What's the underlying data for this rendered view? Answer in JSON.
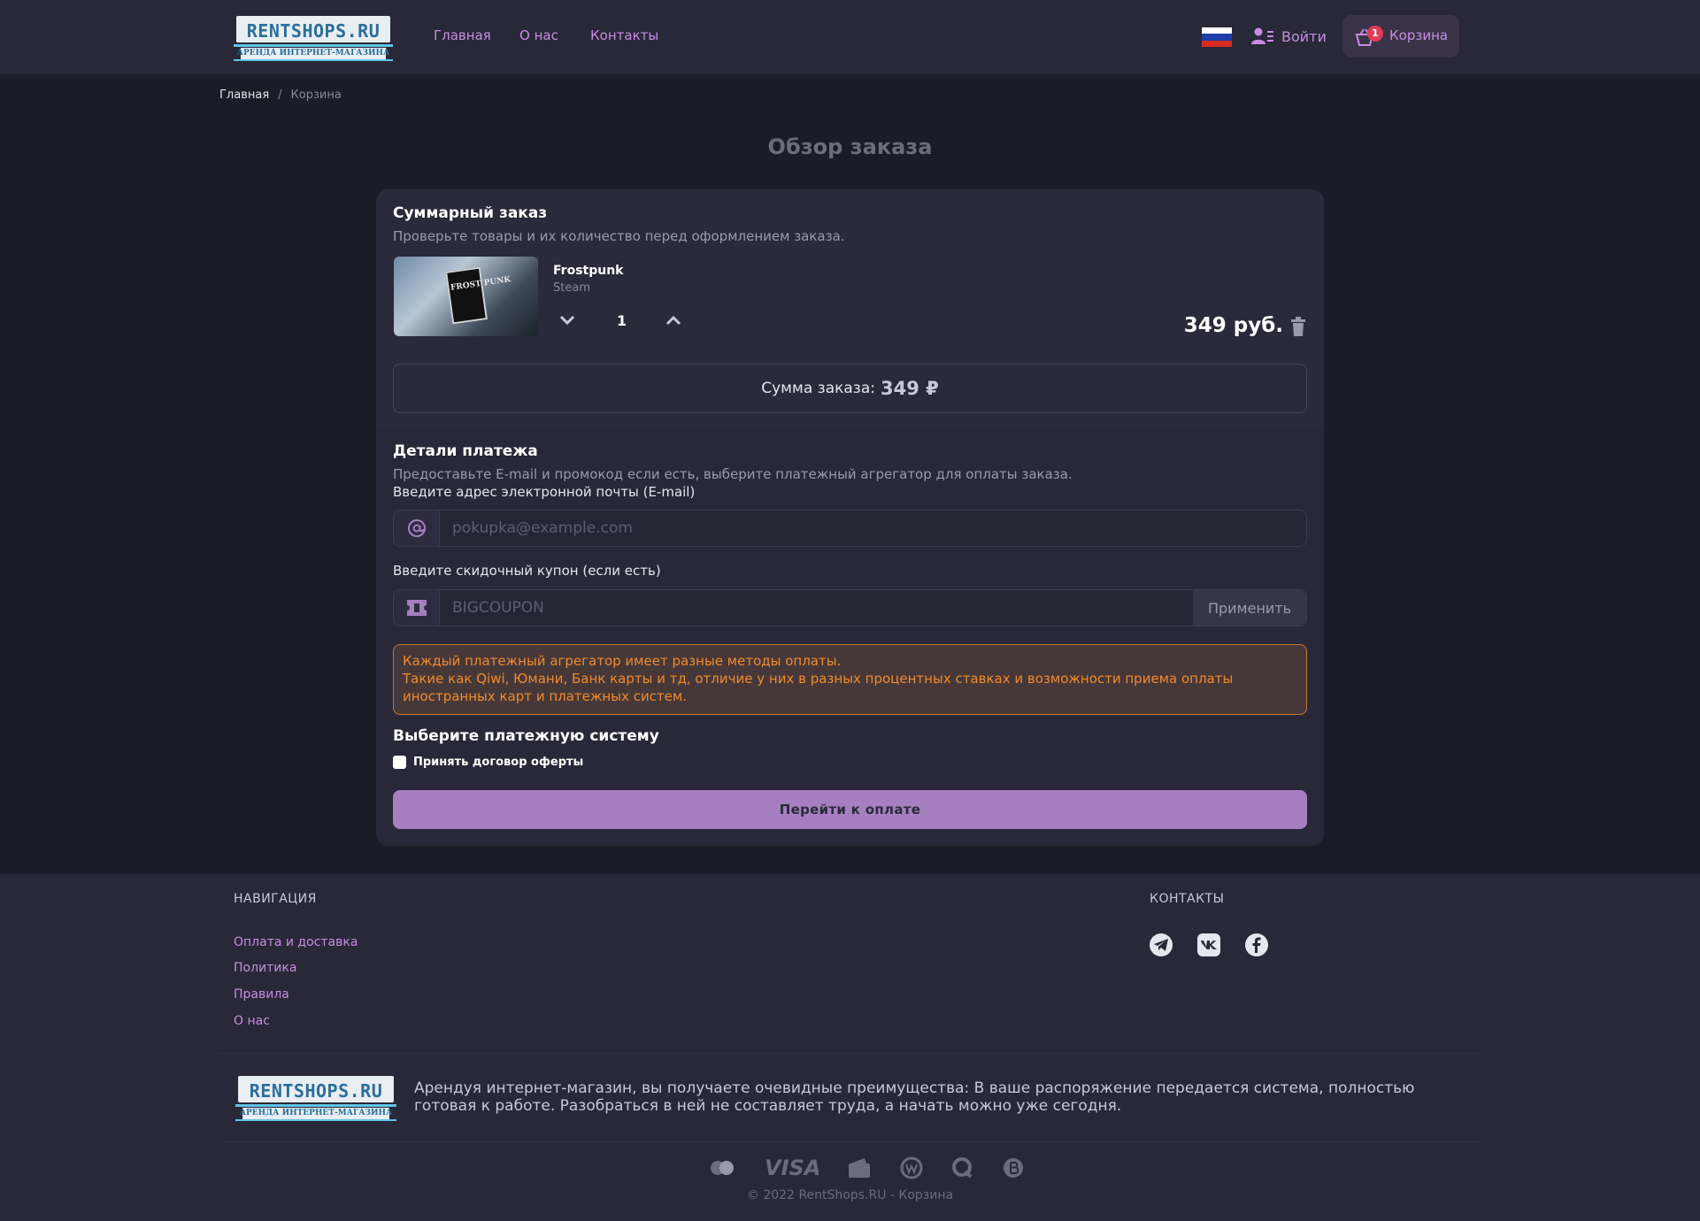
{
  "header": {
    "logo_main": "RENTSHOPS.RU",
    "logo_sub": "АРЕНДА ИНТЕРНЕТ-МАГАЗИНА",
    "nav": [
      "Главная",
      "О нас",
      "Контакты"
    ],
    "login_label": "Войти",
    "cart_label": "Корзина",
    "cart_count": "1",
    "flag_colors": [
      "#ffffff",
      "#1c3fa8",
      "#d52b1e"
    ]
  },
  "breadcrumb": {
    "home": "Главная",
    "separator": "/",
    "current": "Корзина"
  },
  "page_title": "Обзор заказа",
  "order": {
    "title": "Суммарный заказ",
    "subtitle": "Проверьте товары и их количество перед оформлением заказа.",
    "item": {
      "name": "Frostpunk",
      "platform": "Steam",
      "image_text": "FROST PUNK",
      "quantity": "1",
      "price": "349 руб."
    },
    "total_label": "Сумма заказа:",
    "total_value": "349 ₽"
  },
  "payment": {
    "title": "Детали платежа",
    "subtitle": "Предоставьте E-mail и промокод если есть, выберите платежный агрегатор для оплаты заказа.",
    "email_label": "Введите адрес электронной почты (E-mail)",
    "email_placeholder": "pokupka@example.com",
    "coupon_label": "Введите скидочный купон (если есть)",
    "coupon_placeholder": "BIGCOUPON",
    "apply_label": "Применить",
    "warning_line1": "Каждый платежный агрегатор имеет разные методы оплаты.",
    "warning_line2": "Такие как Qiwi, Юмани, Банк карты и тд, отличие у них в разных процентных ставках и возможности приема оплаты иностранных карт и платежных систем.",
    "system_title": "Выберите платежную систему",
    "offer_label": "Принять договор оферты",
    "pay_button": "Перейти к оплате"
  },
  "footer": {
    "nav_title": "НАВИГАЦИЯ",
    "links": [
      "Оплата и доставка",
      "Политика",
      "Правила",
      "О нас"
    ],
    "contacts_title": "КОНТАКТЫ",
    "socials": [
      "telegram-icon",
      "vk-icon",
      "facebook-icon"
    ],
    "description": "Арендуя интернет-магазин, вы получаете очевидные преимущества: В ваше распоряжение передается система, полностью готовая к работе. Разобраться в ней не составляет труда, а начать можно уже сегодня.",
    "payment_icons": [
      "mastercard-icon",
      "visa-icon",
      "wallet-icon",
      "webmoney-icon",
      "qiwi-icon",
      "bitcoin-icon"
    ],
    "visa_text": "VISA",
    "copyright": "© 2022 RentShops.RU - Корзина"
  },
  "colors": {
    "accent": "#c78ee0",
    "button": "#a67fc0",
    "warning": "#f08a2c",
    "badge": "#e03c55"
  }
}
